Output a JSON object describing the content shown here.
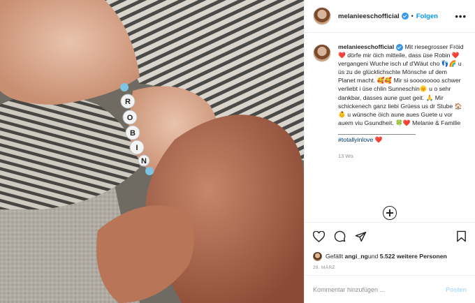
{
  "post": {
    "username": "melanieeschofficial",
    "follow_label": "Folgen",
    "more_label": "•••",
    "dot": "•"
  },
  "caption": {
    "username": "melanieeschofficial",
    "text": " Mit riesegrosser Fröid ❤️ dörfe mir öich mitteile, dass üse Robin ❤️ vergangeni Wuche isch uf d'Wäut cho 👣🌈 u üs zu de glücklichschte Mönsche uf dem Planet macht. 🥰🥰 Mir si soooooooo schwer verliebt i üse chlin Sunneschin🌞 u o sehr dankbar, dasses aune guet geit. 🙏 Mir schickenech ganz liebi Grüess us dr Stube 🏠 👶 u wünsche öich aune aues Guete u vor auem viu Gsundheit. 🍀❤️ Melanie & Familie",
    "divider": "_______________________",
    "hashtag": "#totallyinlove",
    "hashtag_emoji": " ❤️"
  },
  "time_ago": "13 Wo.",
  "likes": {
    "prefix": "Gefällt ",
    "user": "angi_ng",
    "middle": " und ",
    "count": "5.522 weitere Personen"
  },
  "date": "29. MÄRZ",
  "comment": {
    "placeholder": "Kommentar hinzufügen ...",
    "post_label": "Posten"
  },
  "bracelet_letters": [
    "R",
    "O",
    "B",
    "I",
    "N"
  ],
  "colors": {
    "link_blue": "#0095f6",
    "hashtag_blue": "#00376b",
    "muted_gray": "#8e8e8e",
    "post_disabled": "#b2dffc"
  },
  "icons": [
    "heart-icon",
    "comment-icon",
    "share-icon",
    "bookmark-icon",
    "plus-circle-icon",
    "verified-icon"
  ]
}
